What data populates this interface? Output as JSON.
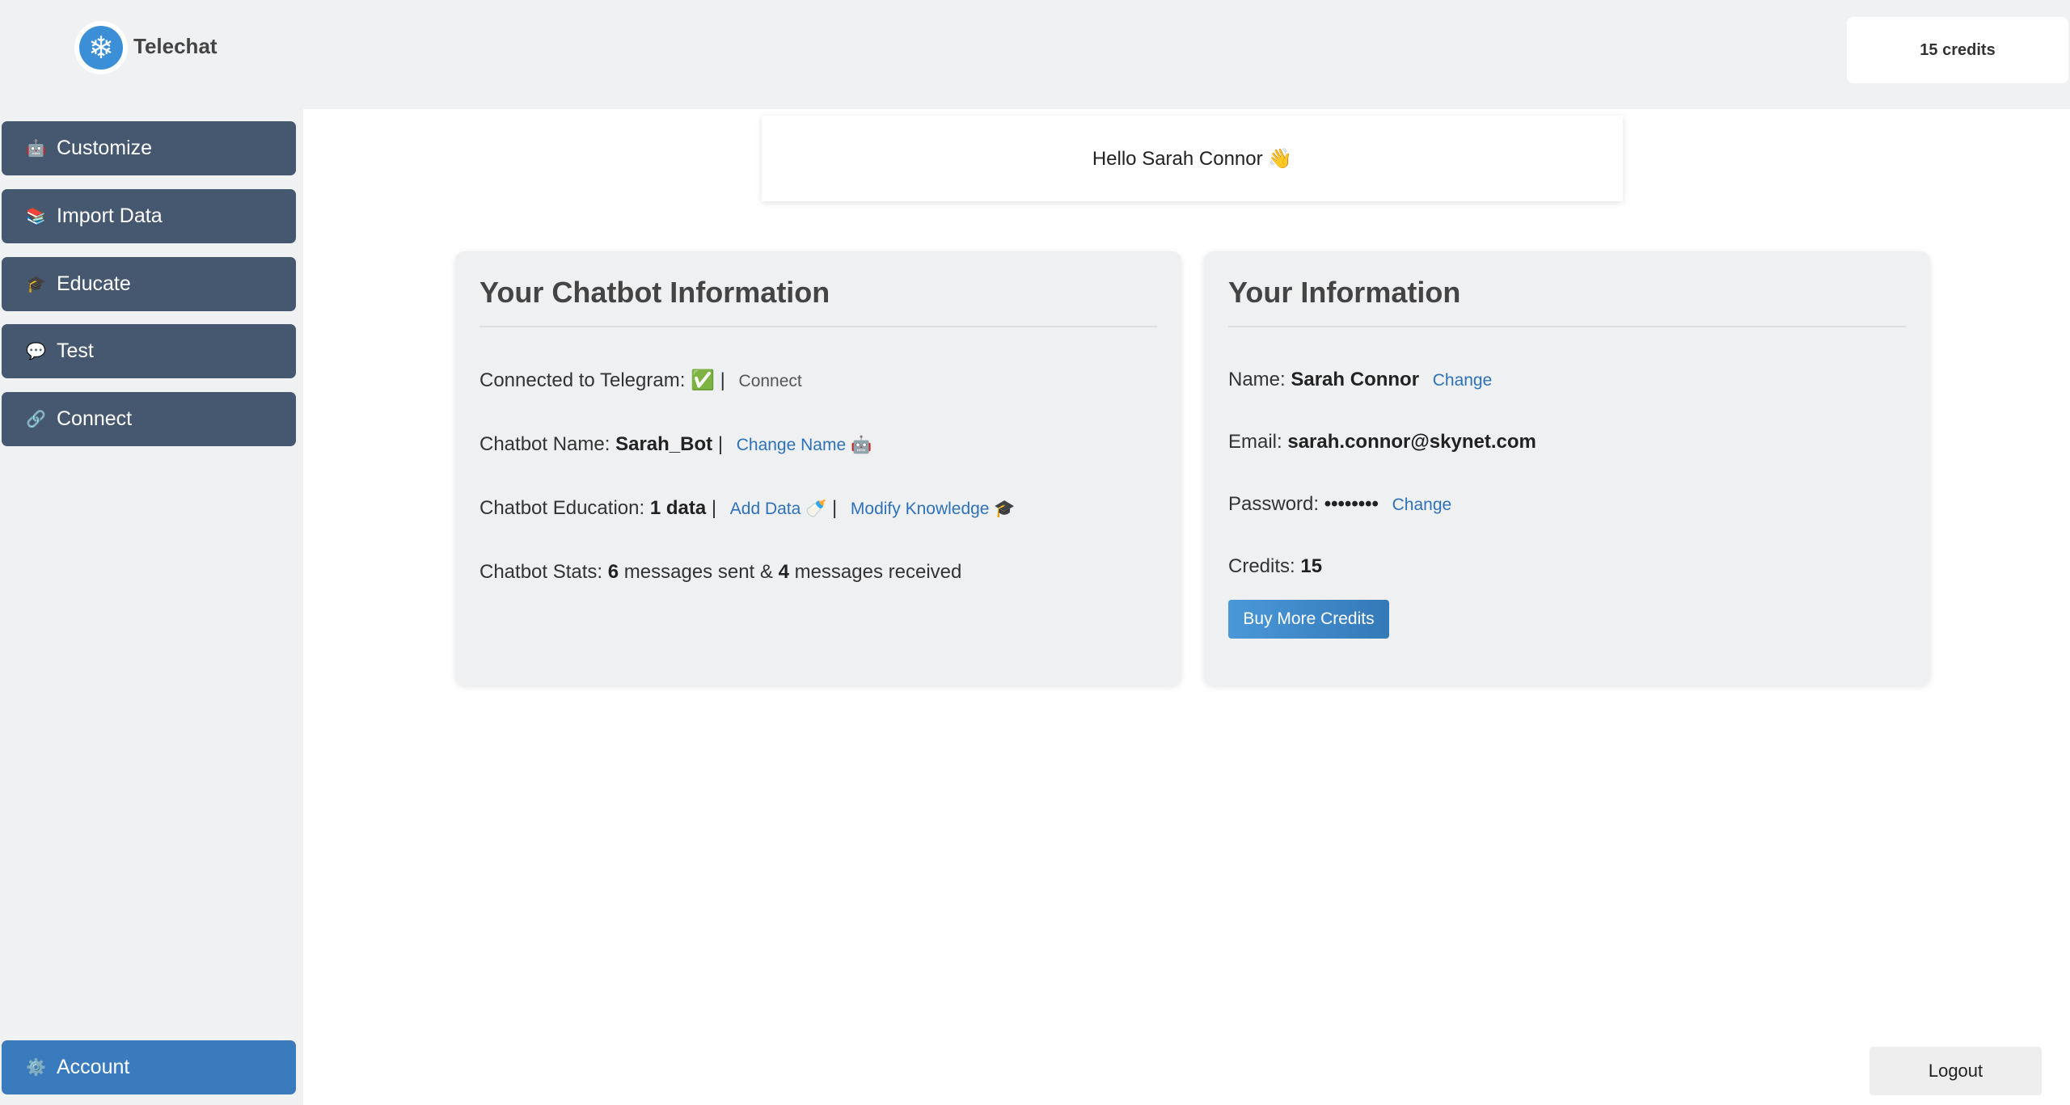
{
  "header": {
    "brand": "Telechat",
    "logo_icon": "snowflake-chat-logo",
    "credits": "15 credits"
  },
  "sidebar": {
    "items": [
      {
        "label": "Customize",
        "icon": "🤖"
      },
      {
        "label": "Import Data",
        "icon": "📚"
      },
      {
        "label": "Educate",
        "icon": "🎓"
      },
      {
        "label": "Test",
        "icon": "💬"
      },
      {
        "label": "Connect",
        "icon": "🔗"
      }
    ],
    "account": {
      "label": "Account",
      "icon": "⚙️"
    }
  },
  "greeting": "Hello Sarah Connor 👋",
  "chatbot": {
    "title": "Your Chatbot Information",
    "telegram_label": "Connected to Telegram:",
    "telegram_status": "✅",
    "sep": "|",
    "connect": "Connect",
    "name_label": "Chatbot Name:",
    "name": "Sarah_Bot",
    "change_name": "Change Name 🤖",
    "education_label": "Chatbot Education:",
    "education": "1 data",
    "add_data": "Add Data 🍼",
    "modify": "Modify Knowledge 🎓",
    "stats_label": "Chatbot Stats:",
    "sent": "6",
    "sent_text": "messages sent &",
    "received": "4",
    "received_text": "messages received"
  },
  "user": {
    "title": "Your Information",
    "name_label": "Name:",
    "name": "Sarah Connor",
    "change": "Change",
    "email_label": "Email:",
    "email": "sarah.connor@skynet.com",
    "password_label": "Password:",
    "password": "••••••••",
    "credits_label": "Credits:",
    "credits": "15",
    "buy": "Buy More Credits"
  },
  "logout": "Logout",
  "colors": {
    "sidebar": "#45586f",
    "account": "#3a7bbd",
    "link": "#2d72b8"
  }
}
